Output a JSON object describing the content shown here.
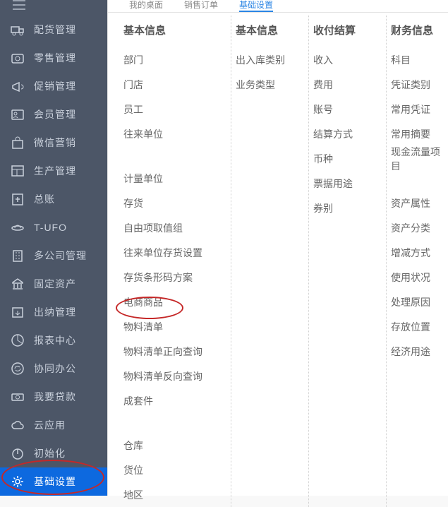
{
  "sidebar": {
    "items": [
      {
        "label": "配货管理",
        "icon": "truck"
      },
      {
        "label": "零售管理",
        "icon": "camera"
      },
      {
        "label": "促销管理",
        "icon": "megaphone"
      },
      {
        "label": "会员管理",
        "icon": "person-card"
      },
      {
        "label": "微信营销",
        "icon": "goods"
      },
      {
        "label": "生产管理",
        "icon": "layout"
      },
      {
        "label": "总账",
        "icon": "ledger"
      },
      {
        "label": "T-UFO",
        "icon": "ufo"
      },
      {
        "label": "多公司管理",
        "icon": "building"
      },
      {
        "label": "固定资产",
        "icon": "bank"
      },
      {
        "label": "出纳管理",
        "icon": "export"
      },
      {
        "label": "报表中心",
        "icon": "chart"
      },
      {
        "label": "协同办公",
        "icon": "refresh-circle"
      },
      {
        "label": "我要贷款",
        "icon": "cash"
      },
      {
        "label": "云应用",
        "icon": "cloud"
      },
      {
        "label": "初始化",
        "icon": "power"
      },
      {
        "label": "基础设置",
        "icon": "gear"
      }
    ],
    "active_index": 16
  },
  "tabs": [
    "我的桌面",
    "销售订单",
    "基础设置"
  ],
  "tabs_active_index": 2,
  "columns": [
    {
      "header": "基本信息",
      "groups": [
        [
          "部门",
          "门店",
          "员工",
          "往来单位"
        ],
        [
          "计量单位",
          "存货",
          "自由项取值组",
          "往来单位存货设置",
          "存货条形码方案",
          "电商商品",
          "物料清单",
          "物料清单正向查询",
          "物料清单反向查询",
          "成套件"
        ],
        [
          "仓库",
          "货位",
          "地区"
        ]
      ]
    },
    {
      "header": "基本信息",
      "groups": [
        [
          "出入库类别",
          "业务类型"
        ]
      ]
    },
    {
      "header": "收付结算",
      "groups": [
        [
          "收入",
          "费用",
          "账号",
          "结算方式",
          "币种",
          "票据用途",
          "券别"
        ]
      ]
    },
    {
      "header": "财务信息",
      "groups": [
        [
          "科目",
          "凭证类别",
          "常用凭证",
          "常用摘要",
          "现金流量项目"
        ],
        [
          "资产属性",
          "资产分类",
          "增减方式",
          "使用状况",
          "处理原因",
          "存放位置",
          "经济用途"
        ]
      ]
    }
  ],
  "annotations": {
    "highlight_sidebar": "基础设置",
    "highlight_content": "物料清单"
  }
}
